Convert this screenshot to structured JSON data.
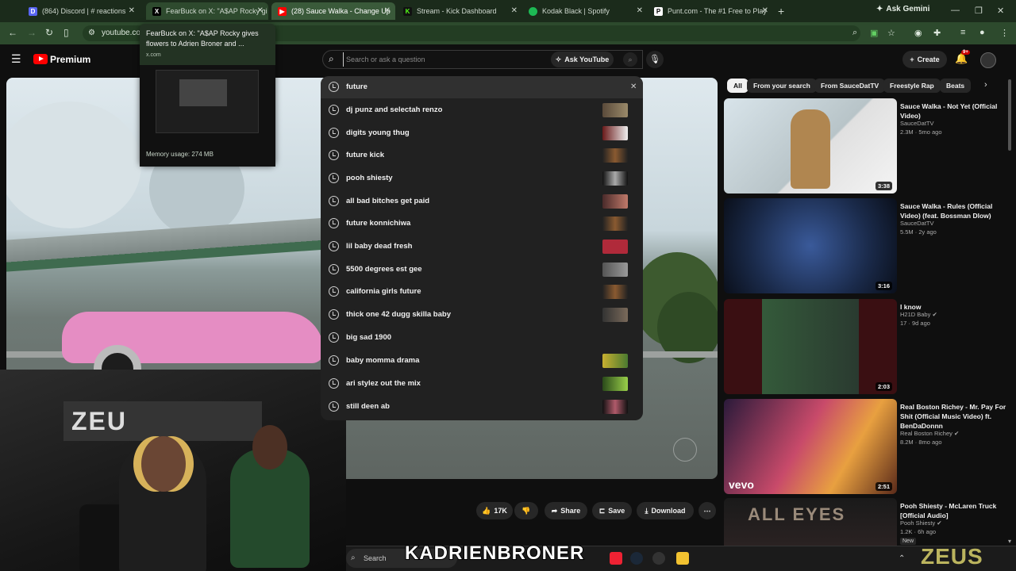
{
  "browser": {
    "tabs": [
      {
        "title": "(864) Discord | #",
        "title2": "reactions",
        "color": "#5865f2",
        "glyph": "D"
      },
      {
        "title": "FearBuck on X: \"A$AP Rocky gi",
        "color": "#000000",
        "glyph": "X"
      },
      {
        "title": "(28) Sauce Walka - Change Up",
        "color": "#ff0000",
        "glyph": "▶"
      },
      {
        "title": "Stream - Kick Dashboard",
        "color": "#53fc18",
        "glyph": "K"
      },
      {
        "title": "Kodak Black | Spotify",
        "color": "#1db954",
        "glyph": "●"
      },
      {
        "title": "Punt.com - The #1 Free to Play",
        "color": "#ffffff",
        "glyph": "P"
      }
    ],
    "ask_gemini": "Ask Gemini",
    "url": "youtube.co",
    "tab_preview": {
      "title": "FearBuck on X: \"A$AP Rocky gives flowers to Adrien Broner and ...",
      "domain": "x.com",
      "memory": "Memory usage: 274 MB"
    }
  },
  "youtube": {
    "brand": "Premium",
    "search": {
      "placeholder": "Search or ask a question",
      "ask_button": "Ask YouTube",
      "suggestions": [
        "future",
        "dj punz and selectah renzo",
        "digits young thug",
        "future kick",
        "pooh shiesty",
        "all bad bitches get paid",
        "future konnichiwa",
        "lil baby dead fresh",
        "5500 degrees est gee",
        "california girls future",
        "thick one 42 dugg skilla baby",
        "big sad 1900",
        "baby momma drama",
        "ari stylez out the mix",
        "still deen ab"
      ]
    },
    "create_label": "Create",
    "notif_badge": "9+",
    "actions": {
      "likes": "17K",
      "share": "Share",
      "save": "Save",
      "download": "Download"
    },
    "chips": [
      "All",
      "From your search",
      "From SauceDatTV",
      "Freestyle Rap",
      "Beats"
    ],
    "recommendations": [
      {
        "title": "Sauce Walka - Not Yet (Official Video)",
        "channel": "SauceDatTV",
        "meta": "2.3M · 5mo ago",
        "duration": "3:38",
        "verified": false,
        "new": false
      },
      {
        "title": "Sauce Walka - Rules (Official Video) (feat. Bossman Dlow)",
        "channel": "SauceDatTV",
        "meta": "5.5M · 2y ago",
        "duration": "3:16",
        "verified": false,
        "new": false
      },
      {
        "title": "I know",
        "channel": "H21D Baby",
        "meta": "17 · 9d ago",
        "duration": "2:03",
        "verified": true,
        "new": false
      },
      {
        "title": "Real Boston Richey - Mr. Pay For Shit (Official Music Video) ft. BenDaDonnn",
        "channel": "Real Boston Richey",
        "meta": "8.2M · 8mo ago",
        "duration": "2:51",
        "verified": true,
        "new": false
      },
      {
        "title": "Pooh Shiesty - McLaren Truck [Official Audio]",
        "channel": "Pooh Shiesty",
        "meta": "1.2K · 6h ago",
        "duration": "",
        "verified": true,
        "new": true,
        "new_label": "New"
      }
    ]
  },
  "overlay": {
    "name_banner": "KADRIENBRONER",
    "watermark": "ZEUS"
  },
  "taskbar": {
    "search_label": "Search"
  }
}
